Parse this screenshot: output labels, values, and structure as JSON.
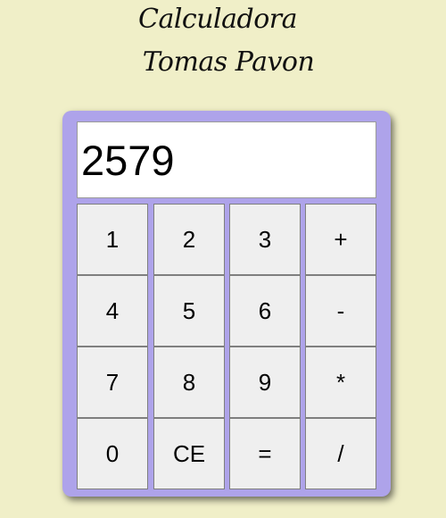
{
  "header": {
    "title_line1": "Calculadora",
    "title_line2": "Tomas Pavon"
  },
  "display": {
    "value": "2579"
  },
  "keys": [
    {
      "name": "key-1",
      "label": "1"
    },
    {
      "name": "key-2",
      "label": "2"
    },
    {
      "name": "key-3",
      "label": "3"
    },
    {
      "name": "key-plus",
      "label": "+"
    },
    {
      "name": "key-4",
      "label": "4"
    },
    {
      "name": "key-5",
      "label": "5"
    },
    {
      "name": "key-6",
      "label": "6"
    },
    {
      "name": "key-minus",
      "label": "-"
    },
    {
      "name": "key-7",
      "label": "7"
    },
    {
      "name": "key-8",
      "label": "8"
    },
    {
      "name": "key-9",
      "label": "9"
    },
    {
      "name": "key-multiply",
      "label": "*"
    },
    {
      "name": "key-0",
      "label": "0"
    },
    {
      "name": "key-clear-entry",
      "label": "CE"
    },
    {
      "name": "key-equals",
      "label": "="
    },
    {
      "name": "key-divide",
      "label": "/"
    }
  ],
  "colors": {
    "page_background": "#f0efc8",
    "calculator_body": "#aea3ea",
    "display_background": "#ffffff",
    "key_background": "#efefef"
  }
}
